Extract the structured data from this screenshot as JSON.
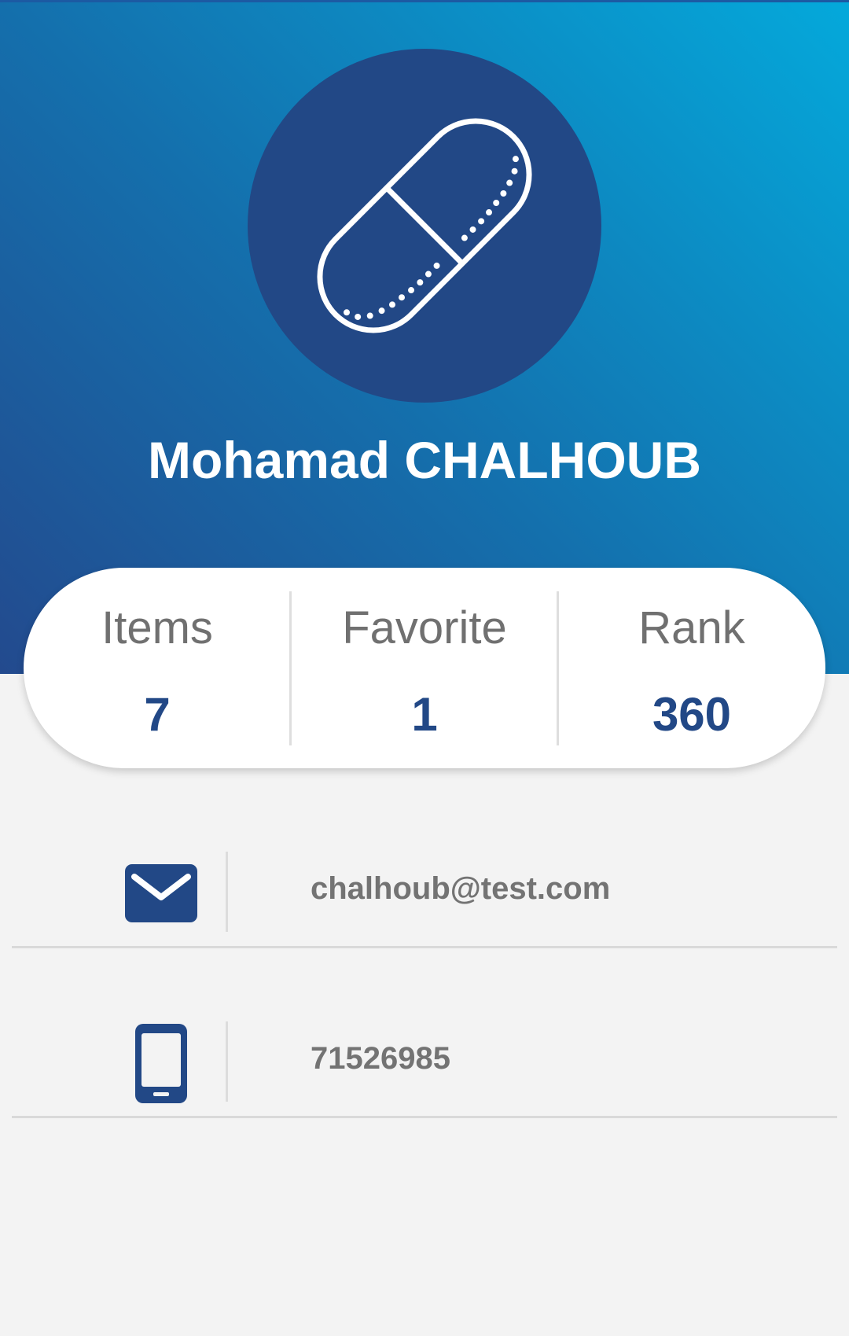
{
  "profile": {
    "name": "Mohamad CHALHOUB",
    "avatar_icon": "capsule-pill-icon"
  },
  "stats": [
    {
      "label": "Items",
      "value": "7"
    },
    {
      "label": "Favorite",
      "value": "1"
    },
    {
      "label": "Rank",
      "value": "360"
    }
  ],
  "contact": {
    "email": {
      "icon": "envelope-icon",
      "value": "chalhoub@test.com"
    },
    "phone": {
      "icon": "mobile-phone-icon",
      "value": "71526985"
    }
  },
  "colors": {
    "brand_dark": "#224886",
    "gradient_start": "#234a8e",
    "gradient_end": "#04a9db",
    "background": "#f3f3f3"
  }
}
